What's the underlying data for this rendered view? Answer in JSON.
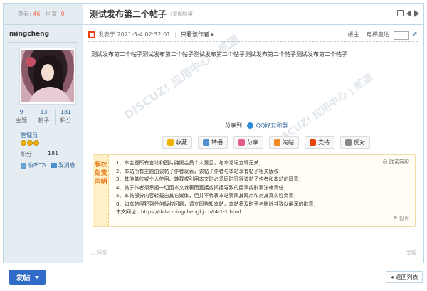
{
  "sidebar": {
    "views_label": "查看:",
    "views_count": "46",
    "replies_label": "回复:",
    "replies_count": "0",
    "username": "mingcheng",
    "stats": [
      {
        "value": "9",
        "label": "主题"
      },
      {
        "value": "13",
        "label": "帖子"
      },
      {
        "value": "181",
        "label": "积分"
      }
    ],
    "group": "管理员",
    "points_label": "积分",
    "points_value": "181",
    "add_friend": "收听TA",
    "send_message": "发消息"
  },
  "post": {
    "title": "测试发布第二个帖子",
    "copy_link": "[复制链接]",
    "posted_at": "发表于 2021-5-4 02:32:01",
    "author_only": "只看该作者",
    "floor_label": "楼主",
    "jump_label": "电梯直达",
    "body": "测试发布第二个帖子测试发布第二个帖子测试发布第二个帖子测试发布第二个帖子测试发布第二个帖子",
    "share_label": "分享到:",
    "share_qq": "QQ好友和群",
    "actions": [
      {
        "icon": "star-icon",
        "label": "收藏",
        "color": "#f0b400"
      },
      {
        "icon": "edit-icon",
        "label": "转播",
        "color": "#4f8fd0"
      },
      {
        "icon": "heart-icon",
        "label": "分享",
        "color": "#e85a8a"
      },
      {
        "icon": "mail-icon",
        "label": "淘帖",
        "color": "#f08a24"
      },
      {
        "icon": "thumbs-up-icon",
        "label": "支持",
        "color": "#e8420d"
      },
      {
        "icon": "thumbs-down-icon",
        "label": "反对",
        "color": "#888888"
      }
    ],
    "notice_stamp": "版权免责声明",
    "notice_service": "联系客服",
    "notice_items": [
      "1、本主题所有言论和图片纯属会员个人意见，与本论坛立场无关；",
      "2、本站所有主题由该帖子作者发表，该帖子作者与本站享有帖子相关版权；",
      "3、其他单位或个人使用、转载或引用本文时必须同时征得该帖子作者和本站的同意；",
      "4、帖子作者须承担一切因本文发表而直接或间接导致的民事或刑事法律责任；",
      "5、本帖部分内容转载自其它媒体，但并不代表本站赞同其观点和对其真实性负责；",
      "6、如本帖侵犯到任何版权问题，请立即告知本站，本站将及时予与删除并致以最深的歉意；",
      "本文网址：https://data.mingchengkj.cn/t4-1-1.html"
    ],
    "report": "投诉",
    "reply": "回复",
    "report_bottom": "举报"
  },
  "footer": {
    "post_button": "发帖",
    "back_to_list": "返回列表"
  },
  "colors": {
    "accent": "#2f6bc7",
    "border": "#c2d5e3",
    "sidebar_bg": "#e5edf2"
  }
}
